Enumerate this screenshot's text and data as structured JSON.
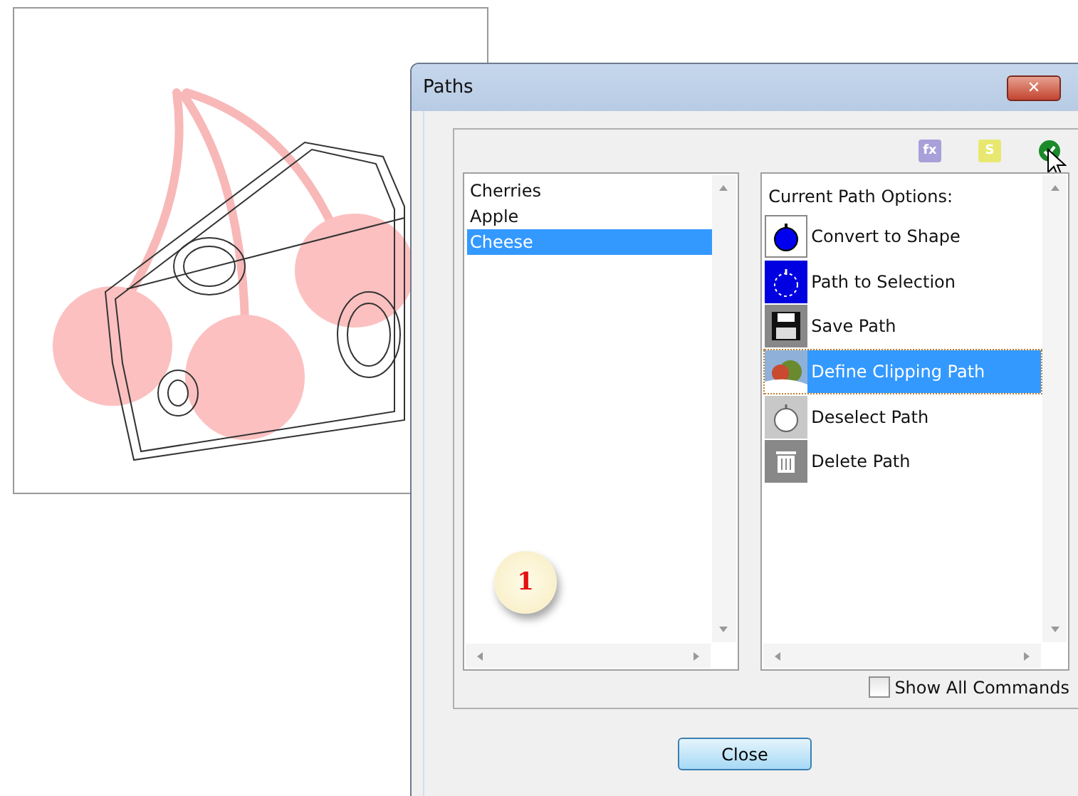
{
  "window": {
    "title": "Paths",
    "close": "✕"
  },
  "toolbar": [
    {
      "kind": "text",
      "label": "fx",
      "color": "#a8a0d8"
    },
    {
      "kind": "text",
      "label": "S",
      "color": "#e8e870"
    },
    {
      "kind": "check",
      "color": "#1a8a2a"
    }
  ],
  "path_list": [
    {
      "label": "Cherries",
      "selected": false
    },
    {
      "label": "Apple",
      "selected": false
    },
    {
      "label": "Cheese",
      "selected": true
    }
  ],
  "options": {
    "heading": "Current Path Options:",
    "items": [
      {
        "kind": "shape",
        "label": "Convert to Shape",
        "selected": false
      },
      {
        "kind": "selection",
        "label": "Path to Selection",
        "selected": false
      },
      {
        "kind": "save",
        "label": "Save Path",
        "selected": false
      },
      {
        "kind": "clip",
        "label": "Define Clipping Path",
        "selected": true
      },
      {
        "kind": "deselect",
        "label": "Deselect Path",
        "selected": false
      },
      {
        "kind": "delete",
        "label": "Delete Path",
        "selected": false
      }
    ]
  },
  "show_all": {
    "label": "Show All Commands",
    "checked": false
  },
  "callout": "1",
  "buttons": [
    "Close"
  ]
}
